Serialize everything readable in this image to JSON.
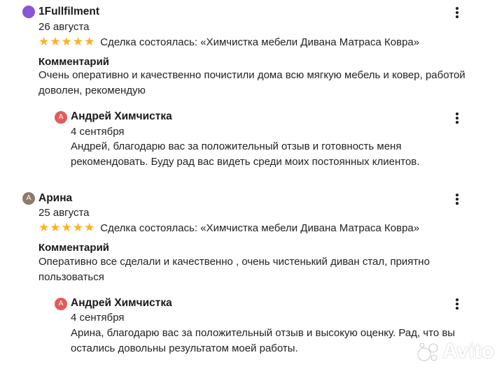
{
  "reviews": [
    {
      "author": "1Fullfilment",
      "avatar_letter": "",
      "avatar_color": "#8a55d6",
      "date": "26 августа",
      "rating": 5,
      "deal": "Сделка состоялась: «Химчистка мебели Дивана Матраса Ковра»",
      "comment_label": "Комментарий",
      "comment": "Очень оперативно и качественно почистили дома всю мягкую мебель и ковер, работой доволен, рекомендую",
      "reply": {
        "author": "Андрей Химчистка",
        "avatar_letter": "А",
        "avatar_color": "#e25b5b",
        "date": "4 сентября",
        "text": "Андрей, благодарю вас за положительный отзыв и готовность меня рекомендовать. Буду рад вас видеть среди моих постоянных клиентов."
      }
    },
    {
      "author": "Арина",
      "avatar_letter": "А",
      "avatar_color": "#8c7a6b",
      "date": "25 августа",
      "rating": 5,
      "deal": "Сделка состоялась: «Химчистка мебели Дивана Матраса Ковра»",
      "comment_label": "Комментарий",
      "comment": "Оперативно все сделали и качественно , очень чистенький диван стал, приятно пользоваться",
      "reply": {
        "author": "Андрей Химчистка",
        "avatar_letter": "А",
        "avatar_color": "#e25b5b",
        "date": "4 сентября",
        "text": "Арина, благодарю вас за положительный отзыв и высокую оценку. Рад, что вы остались довольны результатом моей работы."
      }
    }
  ],
  "star_color": "#ffb021",
  "watermark": "Avito"
}
